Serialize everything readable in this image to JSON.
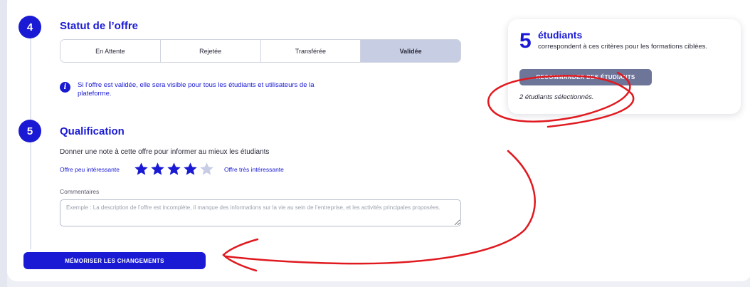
{
  "steps": [
    {
      "number": "4",
      "title": "Statut de l’offre"
    },
    {
      "number": "5",
      "title": "Qualification"
    }
  ],
  "status": {
    "options": [
      "En Attente",
      "Rejetée",
      "Transférée",
      "Validée"
    ],
    "selected": "Validée"
  },
  "info": {
    "icon": "info-icon",
    "text": "Si l’offre est validée, elle sera visible pour tous les étudiants et utilisateurs de la plateforme."
  },
  "qualification": {
    "prompt": "Donner une note à cette offre pour informer au mieux les étudiants",
    "rating_min_label": "Offre peu intéressante",
    "rating_max_label": "Offre très intéressante",
    "rating": 4,
    "rating_max": 5,
    "comment_label": "Commentaires",
    "comment_placeholder": "Exemple : La description de l’offre est incomplète, il manque des informations sur la vie au sein de l’entreprise, et les activités principales proposées."
  },
  "save_button": "MÉMORISER LES CHANGEMENTS",
  "students_card": {
    "count": "5",
    "title": "étudiants",
    "subtitle": "correspondent à ces critères pour les formations ciblées.",
    "recommend_button": "RECOMMANDER DES ÉTUDIANTS",
    "selected_text": "2 étudiants sélectionnés."
  },
  "colors": {
    "accent": "#1a1ad4",
    "selected_status": "#c7cde2",
    "recommend_button": "#6d7599",
    "star_empty": "#c8cde6",
    "annotation": "#e0191f"
  }
}
